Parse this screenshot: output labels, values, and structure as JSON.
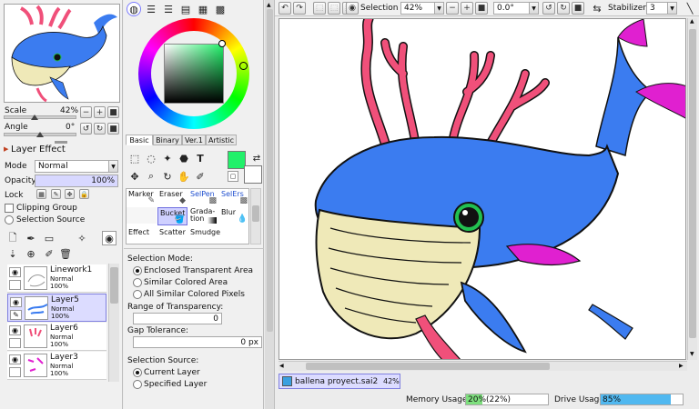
{
  "navigator": {
    "scale_label": "Scale",
    "scale_value": "42%",
    "angle_label": "Angle",
    "angle_value": "0°"
  },
  "layer_effect": {
    "title": "Layer Effect",
    "mode_label": "Mode",
    "mode_value": "Normal",
    "opacity_label": "Opacity",
    "opacity_value": "100%",
    "opacity_fraction": 1.0,
    "lock_label": "Lock",
    "clipping_group": "Clipping Group",
    "selection_source": "Selection Source"
  },
  "layers": [
    {
      "name": "Linework1",
      "mode": "Normal",
      "opacity": "100%",
      "selected": false
    },
    {
      "name": "Layer5",
      "mode": "Normal",
      "opacity": "100%",
      "selected": true
    },
    {
      "name": "Layer6",
      "mode": "Normal",
      "opacity": "100%",
      "selected": false
    },
    {
      "name": "Layer3",
      "mode": "Normal",
      "opacity": "100%",
      "selected": false
    }
  ],
  "color_tabs": [
    "Basic",
    "Binary",
    "Ver.1",
    "Artistic"
  ],
  "primary_color": "#22f06a",
  "brushes": [
    [
      {
        "label": "Marker"
      },
      {
        "label": "Eraser"
      },
      {
        "label": "SelPen",
        "blue": true
      },
      {
        "label": "SelErs",
        "blue": true
      }
    ],
    [
      {
        "label": ""
      },
      {
        "label": "Bucket",
        "selected": true
      },
      {
        "label": "Grada-\ntion"
      },
      {
        "label": "Blur"
      }
    ],
    [
      {
        "label": "Effect"
      },
      {
        "label": "Scatter"
      },
      {
        "label": "Smudge"
      },
      {
        "label": ""
      }
    ]
  ],
  "options": {
    "selection_mode_title": "Selection Mode:",
    "modes": [
      "Enclosed Transparent Area",
      "Similar Colored Area",
      "All Similar Colored Pixels"
    ],
    "range_title": "Range of Transparency:",
    "range_value": "0",
    "gap_title": "Gap Tolerance:",
    "gap_value": "0 px",
    "source_title": "Selection Source:",
    "sources": [
      "Current Layer",
      "Specified Layer"
    ]
  },
  "toolbar": {
    "selection_label": "Selection",
    "zoom_value": "42%",
    "angle_value": "0.0°",
    "stabilizer_label": "Stabilizer",
    "stabilizer_value": "3"
  },
  "document_tab": {
    "name": "ballena proyect.sai2",
    "zoom": "42%"
  },
  "status": {
    "memory_label": "Memory Usage",
    "memory_value": "20%",
    "memory_detail": "(22%)",
    "memory_fraction": 0.2,
    "drive_label": "Drive Usage",
    "drive_value": "85%",
    "drive_fraction": 0.85
  },
  "colors": {
    "accent_blue": "#3b7cf0",
    "whale_pink": "#f0507a",
    "whale_cream": "#efe9b8",
    "usage_green": "#7ee07e",
    "usage_blue": "#50b8f0"
  }
}
